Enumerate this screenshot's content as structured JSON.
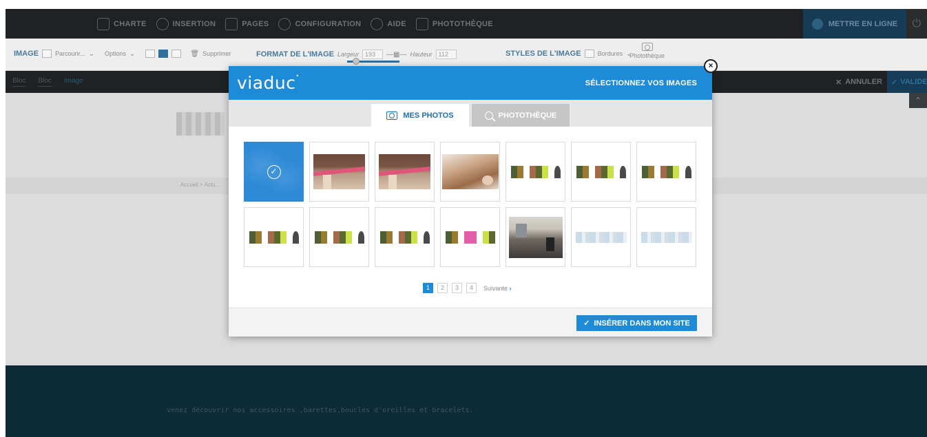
{
  "topnav": {
    "items": [
      "CHARTE",
      "INSERTION",
      "PAGES",
      "CONFIGURATION",
      "AIDE",
      "PHOTOTHÈQUE"
    ],
    "publish": "METTRE EN LIGNE"
  },
  "toolbar": {
    "image_label": "IMAGE",
    "parcourir": "Parcourir...",
    "options": "Options",
    "supprimer": "Supprimer",
    "format_label": "FORMAT DE L'IMAGE",
    "largeur_label": "Largeur",
    "largeur_value": "193",
    "hauteur_label": "Hauteur",
    "hauteur_value": "112",
    "styles_label": "STYLES DE L'IMAGE",
    "bordures": "Bordures",
    "phototheque": "Photothèque"
  },
  "subbar": {
    "crumbs": [
      "Bloc",
      "Bloc",
      "Image"
    ],
    "cancel": "ANNULER",
    "validate": "VALIDER"
  },
  "page": {
    "breadcrumb": "Accueil > Actu...",
    "footer_text": "venez découvrir nos accessoires ,barettes,boucles d'oreilles et bracelets."
  },
  "modal": {
    "logo": "viaduc",
    "title": "SÉLECTIONNEZ VOS IMAGES",
    "close": "×",
    "tabs": [
      {
        "label": "MES PHOTOS",
        "active": true
      },
      {
        "label": "PHOTOTHÈQUE",
        "active": false
      }
    ],
    "thumbnails": [
      {
        "kind": "selected"
      },
      {
        "kind": "hair"
      },
      {
        "kind": "hair"
      },
      {
        "kind": "brush"
      },
      {
        "kind": "strip"
      },
      {
        "kind": "strip"
      },
      {
        "kind": "strip"
      },
      {
        "kind": "strip"
      },
      {
        "kind": "strip"
      },
      {
        "kind": "strip"
      },
      {
        "kind": "strip2"
      },
      {
        "kind": "salon"
      },
      {
        "kind": "blur"
      },
      {
        "kind": "blur"
      }
    ],
    "pagination": {
      "pages": [
        "1",
        "2",
        "3",
        "4"
      ],
      "current": "1",
      "next": "Suivante"
    },
    "insert_button": "INSÉRER DANS MON SITE"
  }
}
